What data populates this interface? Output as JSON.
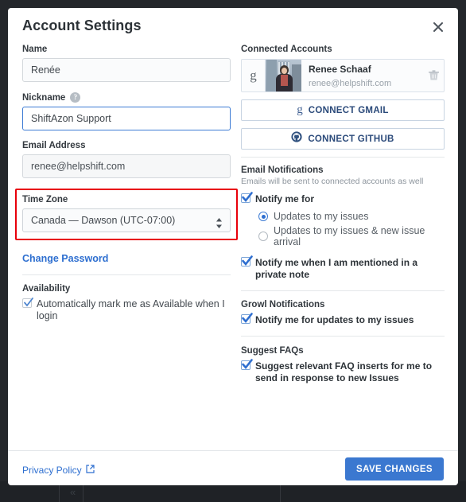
{
  "backdrop": {
    "color": "#24272b"
  },
  "modal": {
    "title": "Account Settings",
    "close_icon": "close-icon"
  },
  "left": {
    "name": {
      "label": "Name",
      "value": "Renée"
    },
    "nickname": {
      "label": "Nickname",
      "value": "ShiftAzon Support",
      "help_icon": "?",
      "focused": true
    },
    "email": {
      "label": "Email Address",
      "value": "renee@helpshift.com"
    },
    "timezone": {
      "label": "Time Zone",
      "value": "Canada — Dawson (UTC-07:00)",
      "highlight_color": "#e8000b"
    },
    "change_password": "Change Password",
    "availability": {
      "title": "Availability",
      "checkbox_label": "Automatically mark me as Available when I login",
      "checked": true
    }
  },
  "right": {
    "connected_accounts": {
      "title": "Connected Accounts",
      "account": {
        "provider_icon": "google-g-icon",
        "name": "Renee Schaaf",
        "email": "renee@helpshift.com",
        "delete_icon": "trash-icon"
      },
      "connect_gmail": "CONNECT GMAIL",
      "connect_github": "CONNECT GITHUB"
    },
    "email_notifications": {
      "title": "Email Notifications",
      "subtitle": "Emails will be sent to connected accounts as well",
      "notify_me_for": {
        "label": "Notify me for",
        "checked": true
      },
      "radios": [
        {
          "label": "Updates to my issues",
          "selected": true
        },
        {
          "label": "Updates to my issues & new issue arrival",
          "selected": false
        }
      ],
      "mention": {
        "label": "Notify me when I am mentioned in a private note",
        "checked": true
      }
    },
    "growl_notifications": {
      "title": "Growl Notifications",
      "item": {
        "label": "Notify me for updates to my issues",
        "checked": true
      }
    },
    "suggest_faqs": {
      "title": "Suggest FAQs",
      "item": {
        "label": "Suggest relevant FAQ inserts for me to send in response to new Issues",
        "checked": true
      }
    }
  },
  "footer": {
    "privacy_policy": "Privacy Policy",
    "external_link_icon": "external-link-icon",
    "save_changes": "SAVE CHANGES",
    "save_color": "#3b78d0"
  }
}
